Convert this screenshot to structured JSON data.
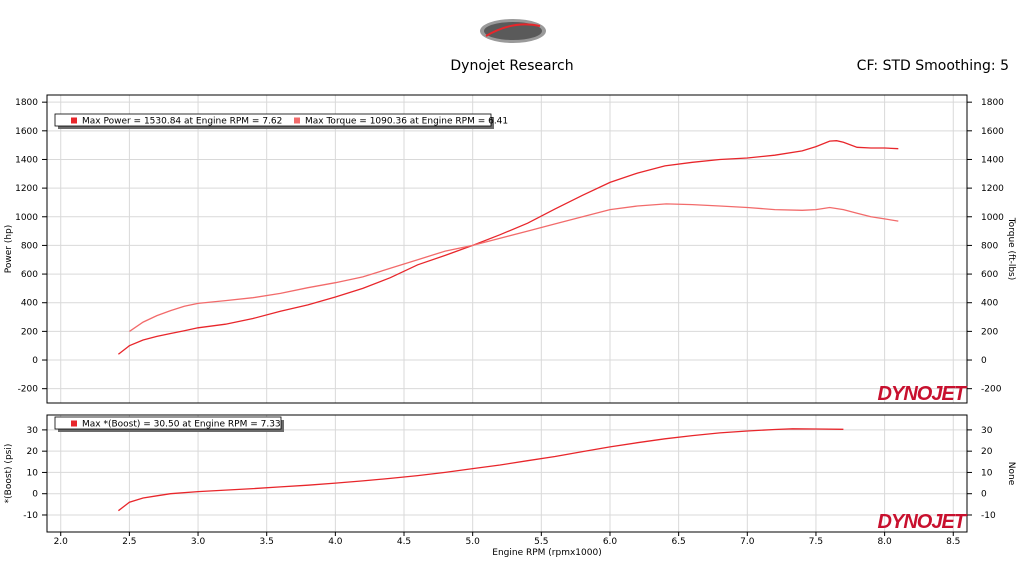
{
  "header": {
    "logo_text": "PARAMOUNT SPEED",
    "title": "Dynojet Research",
    "cf_label": "CF: STD Smoothing: 5"
  },
  "watermark": "DYNOJET",
  "colors": {
    "power": "#e8262b",
    "torque": "#f26b6b",
    "boost": "#e8262b",
    "grid": "#d9d9d9"
  },
  "chart_data": [
    {
      "type": "line",
      "xlabel": "",
      "ylabel": "Power (hp)",
      "ylabel_right": "Torque (ft-lbs)",
      "xlim": [
        1.9,
        8.6
      ],
      "ylim": [
        -300,
        1850
      ],
      "yticks": [
        -200,
        0,
        200,
        400,
        600,
        800,
        1000,
        1200,
        1400,
        1600,
        1800
      ],
      "grid": true,
      "legend": [
        "Max Power = 1530.84 at Engine RPM = 7.62",
        "Max Torque = 1090.36 at Engine RPM = 6.41"
      ],
      "series": [
        {
          "key": "power",
          "x": [
            2.42,
            2.5,
            2.6,
            2.7,
            2.8,
            2.9,
            3.0,
            3.2,
            3.4,
            3.6,
            3.8,
            4.0,
            4.2,
            4.4,
            4.6,
            4.8,
            5.0,
            5.2,
            5.4,
            5.6,
            5.8,
            6.0,
            6.2,
            6.4,
            6.6,
            6.8,
            7.0,
            7.2,
            7.4,
            7.5,
            7.6,
            7.65,
            7.7,
            7.8,
            7.9,
            8.0,
            8.1
          ],
          "values": [
            40,
            100,
            140,
            165,
            185,
            205,
            225,
            250,
            290,
            340,
            385,
            440,
            500,
            575,
            665,
            730,
            800,
            875,
            955,
            1055,
            1150,
            1240,
            1305,
            1355,
            1380,
            1400,
            1410,
            1430,
            1460,
            1490,
            1528,
            1531,
            1520,
            1485,
            1480,
            1480,
            1475
          ]
        },
        {
          "key": "torque",
          "x": [
            2.5,
            2.6,
            2.7,
            2.8,
            2.9,
            3.0,
            3.2,
            3.4,
            3.6,
            3.8,
            4.0,
            4.2,
            4.4,
            4.6,
            4.8,
            5.0,
            5.2,
            5.4,
            5.6,
            5.8,
            6.0,
            6.2,
            6.41,
            6.6,
            6.8,
            7.0,
            7.2,
            7.4,
            7.5,
            7.6,
            7.7,
            7.8,
            7.9,
            8.0,
            8.1
          ],
          "values": [
            200,
            265,
            310,
            345,
            375,
            395,
            415,
            435,
            465,
            505,
            540,
            580,
            640,
            700,
            760,
            800,
            850,
            900,
            950,
            1000,
            1050,
            1075,
            1090,
            1085,
            1075,
            1065,
            1050,
            1045,
            1050,
            1065,
            1050,
            1025,
            1000,
            985,
            970
          ]
        }
      ]
    },
    {
      "type": "line",
      "xlabel": "Engine RPM (rpmx1000)",
      "ylabel": "*(Boost) (psi)",
      "ylabel_right": "None",
      "xlim": [
        1.9,
        8.6
      ],
      "xticks": [
        2.0,
        2.5,
        3.0,
        3.5,
        4.0,
        4.5,
        5.0,
        5.5,
        6.0,
        6.5,
        7.0,
        7.5,
        8.0,
        8.5
      ],
      "ylim": [
        -18,
        37
      ],
      "yticks": [
        -10,
        0,
        10,
        20,
        30
      ],
      "grid": true,
      "legend": [
        "Max *(Boost) = 30.50 at Engine RPM = 7.33"
      ],
      "series": [
        {
          "key": "boost",
          "x": [
            2.42,
            2.5,
            2.6,
            2.7,
            2.8,
            3.0,
            3.2,
            3.4,
            3.6,
            3.8,
            4.0,
            4.2,
            4.4,
            4.6,
            4.8,
            5.0,
            5.2,
            5.4,
            5.6,
            5.8,
            6.0,
            6.2,
            6.4,
            6.6,
            6.8,
            7.0,
            7.2,
            7.33,
            7.5,
            7.7
          ],
          "values": [
            -8,
            -4,
            -2,
            -1,
            0,
            1,
            1.7,
            2.4,
            3.2,
            4,
            5,
            6,
            7.2,
            8.5,
            10,
            11.8,
            13.5,
            15.5,
            17.5,
            19.8,
            22,
            24,
            25.8,
            27.3,
            28.6,
            29.5,
            30.2,
            30.5,
            30.4,
            30.3
          ]
        }
      ]
    }
  ]
}
